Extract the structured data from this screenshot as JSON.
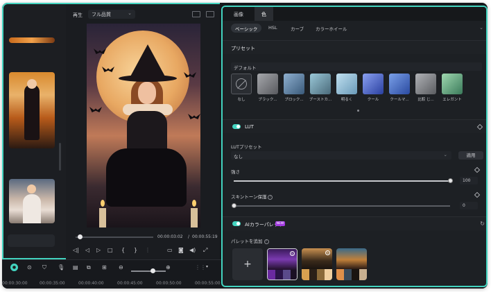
{
  "preview": {
    "label": "再生",
    "quality": "フル品質",
    "time_current": "00:00:03:02",
    "time_sep": "/",
    "time_total": "00:00:55:19"
  },
  "timeline": {
    "ruler": [
      "00:00:30:00",
      "00:00:35:00",
      "00:00:40:00",
      "00:00:45:00",
      "00:00:50:00",
      "00:00:55:00"
    ]
  },
  "panel": {
    "tabs": [
      {
        "label": "画像",
        "active": false
      },
      {
        "label": "色",
        "active": true
      }
    ],
    "subtabs": [
      {
        "label": "ベーシック",
        "active": true
      },
      {
        "label": "HSL",
        "active": false
      },
      {
        "label": "カーブ",
        "active": false
      },
      {
        "label": "カラーホイール",
        "active": false
      }
    ],
    "preset_section": {
      "title": "プリセット",
      "selected": "デフォルト",
      "items": [
        {
          "label": "なし",
          "icon": "none-icon"
        },
        {
          "label": "ブラック...",
          "color": "#8b8c90"
        },
        {
          "label": "ブロック...",
          "color": "#6f8fb0"
        },
        {
          "label": "ブーストカ...",
          "color": "#7aa2b8"
        },
        {
          "label": "明るく",
          "color": "#9ac0d6"
        },
        {
          "label": "クール",
          "color": "#5a78c8"
        },
        {
          "label": "クールマ...",
          "color": "#4a6ab8"
        },
        {
          "label": "比較 じ...",
          "color": "#8a8c90"
        },
        {
          "label": "エレガント",
          "color": "#7ab090"
        }
      ]
    },
    "lut": {
      "title": "LUT",
      "preset_label": "LUTプリセット",
      "selected": "なし",
      "apply_button": "適用"
    },
    "strength": {
      "label": "強さ",
      "value": "100",
      "fraction": 1.0
    },
    "skin_tone": {
      "label": "スキントーン保護",
      "value": "0",
      "fraction": 0.0
    },
    "ai_palette": {
      "title": "AIカラーパレット",
      "badge": "NEW",
      "add_label": "パレットを追加",
      "add_button": "+"
    },
    "accent_color": "#43d4c0"
  }
}
